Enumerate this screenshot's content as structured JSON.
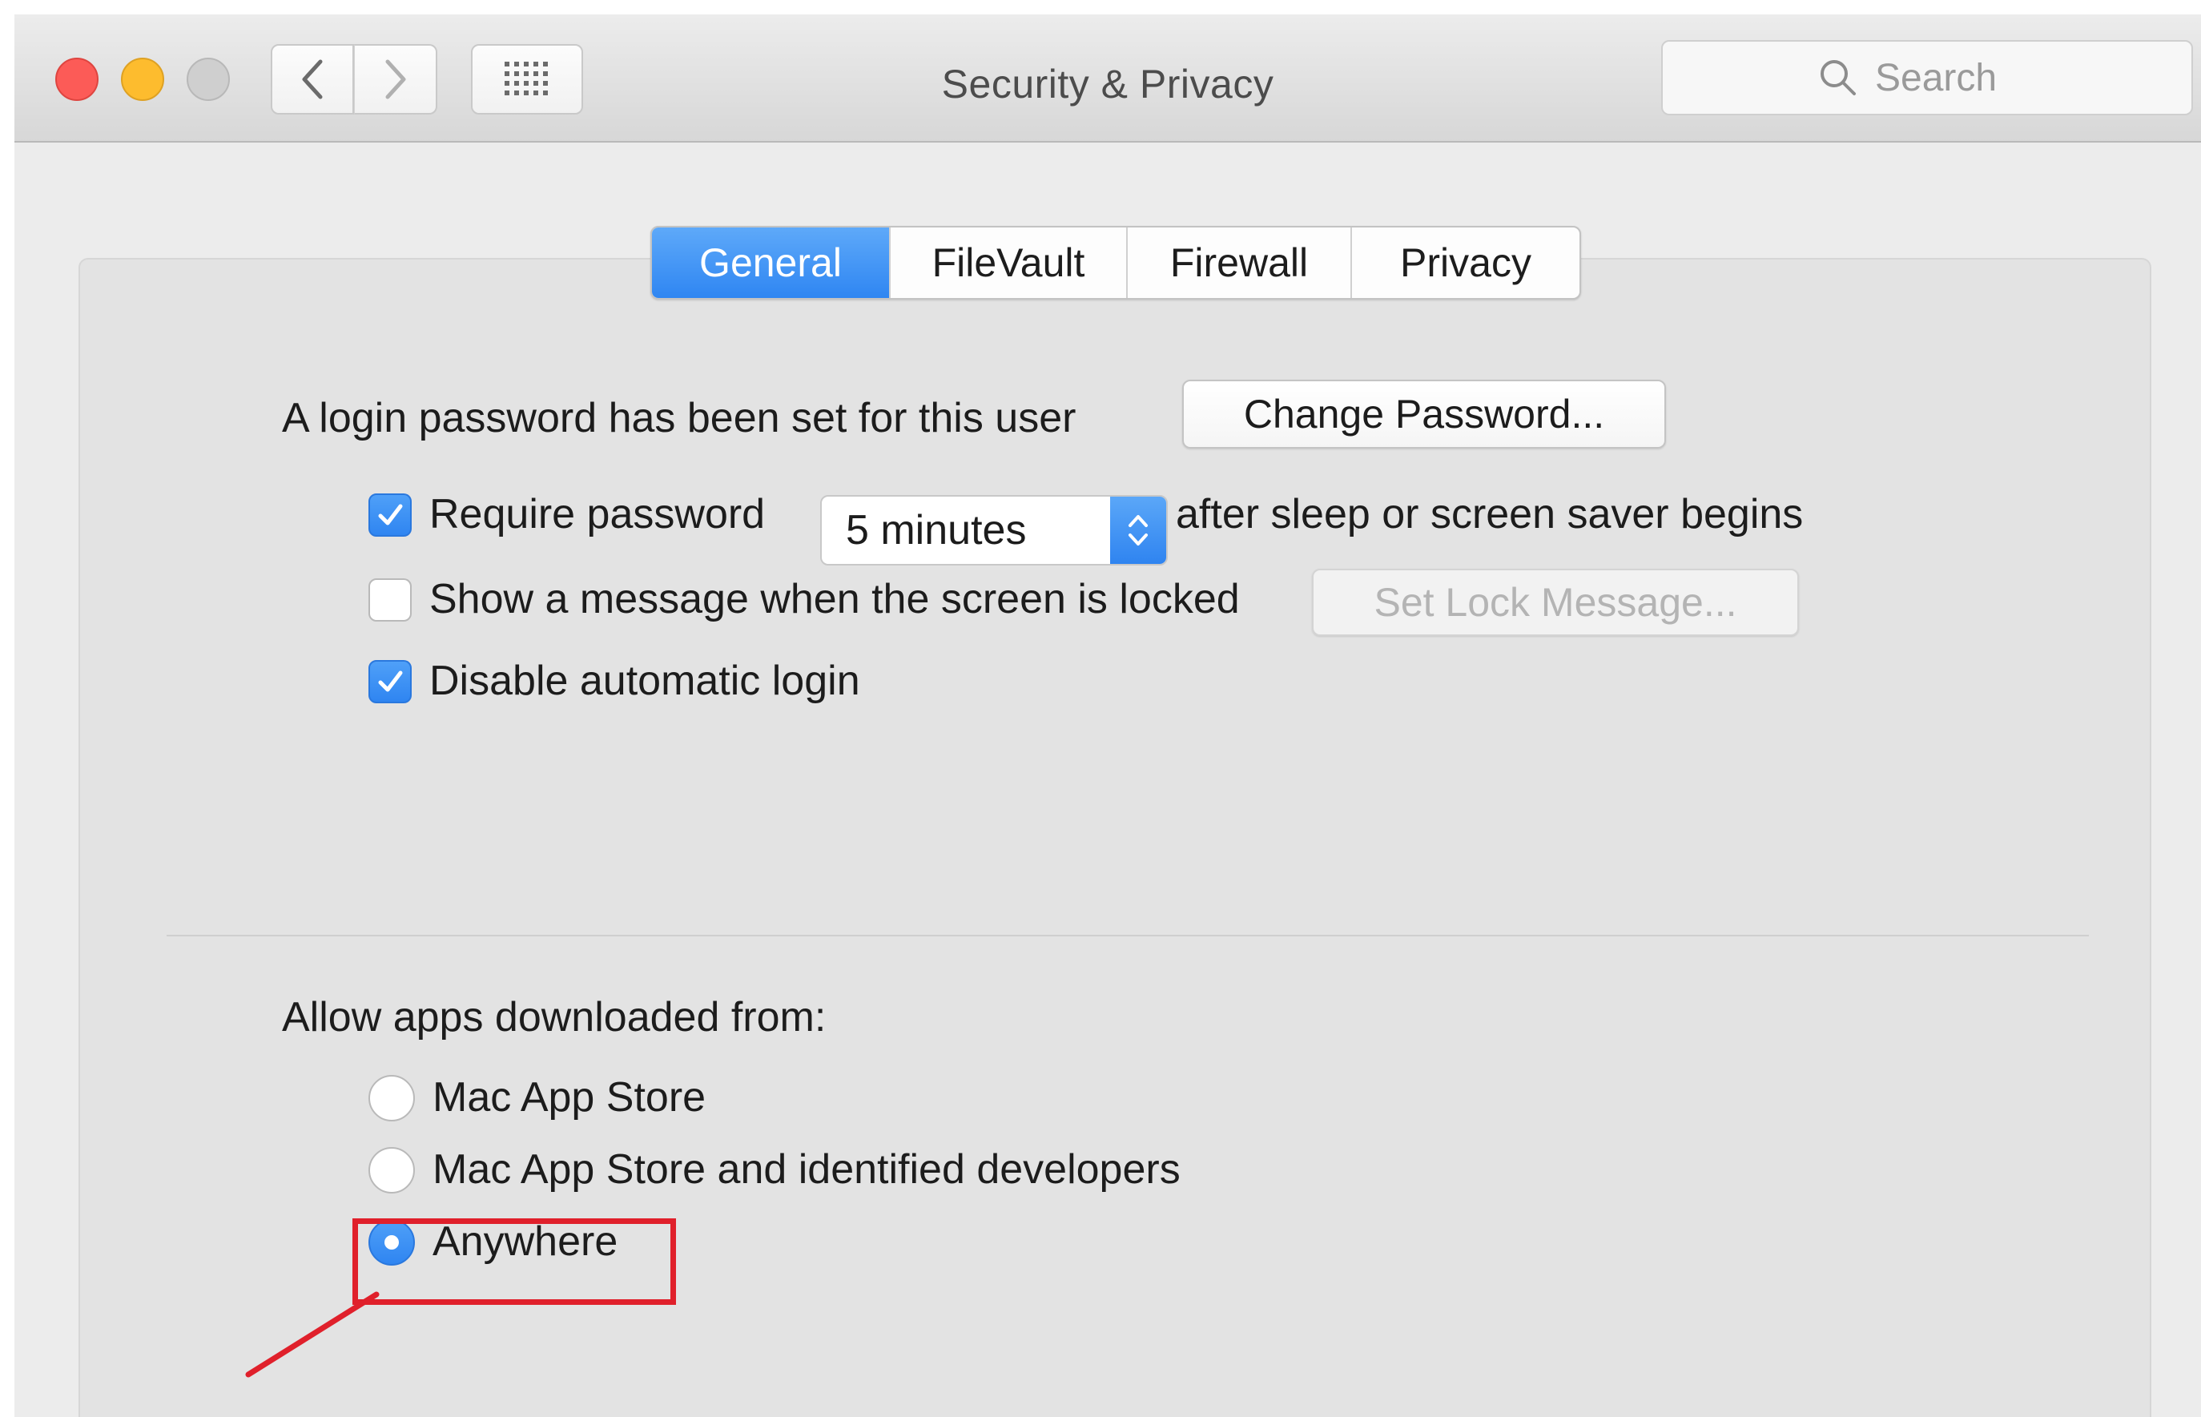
{
  "window": {
    "title": "Security & Privacy"
  },
  "toolbar": {
    "back_icon": "chevron-left-icon",
    "forward_icon": "chevron-right-icon",
    "grid_icon": "grid-icon"
  },
  "search": {
    "placeholder": "Search",
    "icon": "search-icon"
  },
  "tabs": [
    {
      "label": "General",
      "active": true
    },
    {
      "label": "FileVault",
      "active": false
    },
    {
      "label": "Firewall",
      "active": false
    },
    {
      "label": "Privacy",
      "active": false
    }
  ],
  "general": {
    "login_password_text": "A login password has been set for this user",
    "change_password_label": "Change Password...",
    "require_password": {
      "label": "Require password",
      "checked": true,
      "select_value": "5 minutes",
      "suffix": "after sleep or screen saver begins"
    },
    "show_message": {
      "label": "Show a message when the screen is locked",
      "checked": false,
      "button_label": "Set Lock Message..."
    },
    "disable_auto_login": {
      "label": "Disable automatic login",
      "checked": true
    }
  },
  "allow_apps": {
    "heading": "Allow apps downloaded from:",
    "options": [
      {
        "label": "Mac App Store",
        "selected": false
      },
      {
        "label": "Mac App Store and identified developers",
        "selected": false
      },
      {
        "label": "Anywhere",
        "selected": true
      }
    ]
  },
  "colors": {
    "accent_blue": "#2f86f2",
    "annotation_red": "#e0202b",
    "close": "#fc5b57",
    "minimize": "#fdbc2e",
    "zoom_disabled": "#cfcfcf"
  }
}
